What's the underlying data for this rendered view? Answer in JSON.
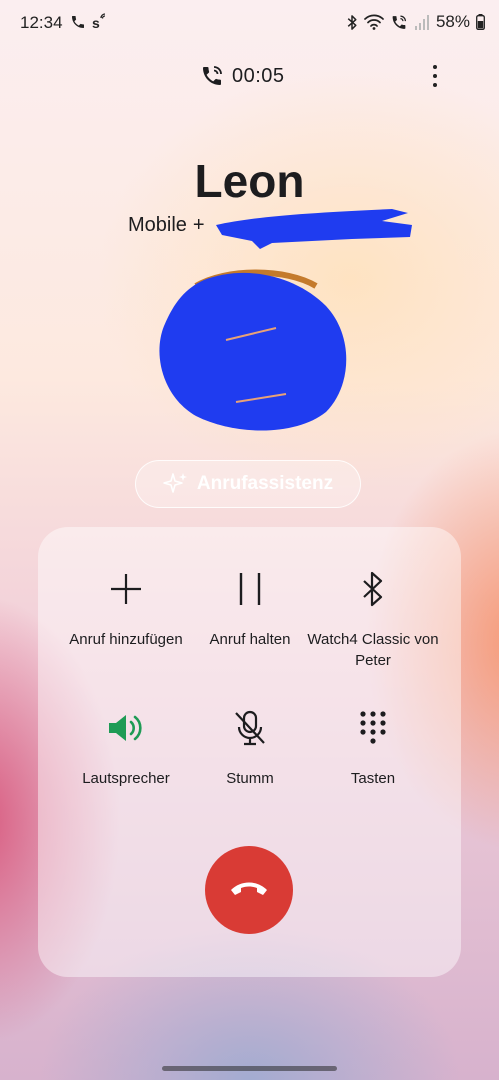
{
  "status_bar": {
    "time": "12:34",
    "battery": "58%",
    "icons": [
      "phone-icon",
      "sim-signal-icon",
      "bluetooth-icon",
      "wifi-icon",
      "wifi-calling-icon",
      "cell-signal-icon",
      "battery-icon"
    ]
  },
  "call": {
    "timer": "00:05",
    "caller_name": "Leon",
    "number_label": "Mobile",
    "number_prefix": "+",
    "assist_label": "Anrufassistenz"
  },
  "controls": {
    "add_call": "Anruf hinzufügen",
    "hold_call": "Anruf halten",
    "bluetooth_device": "Watch4 Classic von Peter",
    "speaker": "Lautsprecher",
    "mute": "Stumm",
    "keypad": "Tasten"
  },
  "colors": {
    "speaker_active": "#1e9b55",
    "end_call": "#d93b35",
    "redaction": "#1f3cf0"
  }
}
